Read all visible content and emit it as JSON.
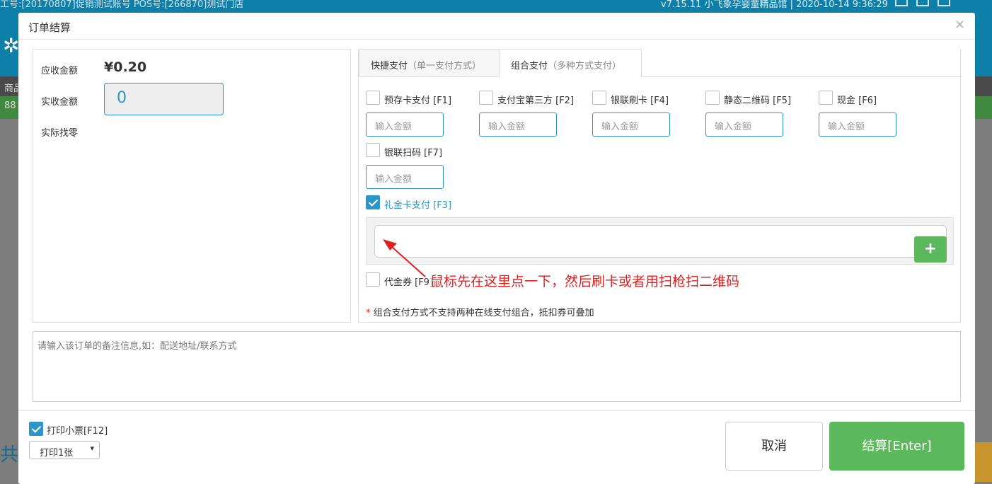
{
  "background": {
    "top_left": "工号:[20170807]促销测试账号  POS号:[266870]测试门店",
    "top_right": "v7.15.11 小飞象孕婴童精品馆 | 2020-10-14 9:36:29",
    "bar1_text": "商品",
    "bar2_text": "88",
    "bottom_text": "共"
  },
  "modal": {
    "title": "订单结算",
    "close": "×"
  },
  "left": {
    "receivable_label": "应收金额",
    "receivable_value": "¥0.20",
    "actual_label": "实收金额",
    "actual_value": "0",
    "change_label": "实际找零"
  },
  "tabs": [
    {
      "label": "快捷支付",
      "sub": "（单一支付方式）"
    },
    {
      "label": "组合支付",
      "sub": "（多种方式支付）"
    }
  ],
  "payments": [
    {
      "label": "预存卡支付 [F1]",
      "placeholder": "输入金额",
      "checked": false
    },
    {
      "label": "支付宝第三方 [F2]",
      "placeholder": "输入金额",
      "checked": false
    },
    {
      "label": "银联刷卡 [F4]",
      "placeholder": "输入金额",
      "checked": false
    },
    {
      "label": "静态二维码 [F5]",
      "placeholder": "输入金额",
      "checked": false
    },
    {
      "label": "现金 [F6]",
      "placeholder": "输入金额",
      "checked": false
    },
    {
      "label": "银联扫码 [F7]",
      "placeholder": "输入金额",
      "checked": false
    }
  ],
  "giftcard": {
    "label": "礼金卡支付 [F3]",
    "checked": true,
    "add_icon": "plus-icon"
  },
  "voucher": {
    "label": "代金券 [F9]",
    "checked": false
  },
  "annotation": "鼠标先在这里点一下，然后刷卡或者用扫枪扫二维码",
  "note": {
    "star": "*",
    "text": "组合支付方式不支持两种在线支付组合，抵扣券可叠加"
  },
  "remark_placeholder": "请输入该订单的备注信息,如：配送地址/联系方式",
  "footer": {
    "print_label": "打印小票[F12]",
    "print_checked": true,
    "print_select": "打印1张",
    "cancel": "取消",
    "confirm": "结算[Enter]"
  },
  "colors": {
    "accent": "#2a97c8",
    "confirm": "#5cb85c",
    "annotation": "#e02020"
  }
}
